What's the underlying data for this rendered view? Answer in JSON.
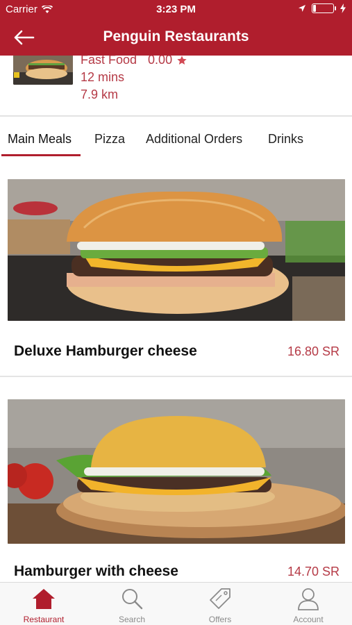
{
  "status_bar": {
    "carrier": "Carrier",
    "time": "3:23 PM"
  },
  "nav": {
    "title": "Penguin Restaurants"
  },
  "restaurant": {
    "category": "Fast Food",
    "rating": "0.00",
    "delivery_time": "12 mins",
    "distance": "7.9 km"
  },
  "tabs": [
    {
      "label": "Main Meals",
      "active": true
    },
    {
      "label": "Pizza"
    },
    {
      "label": "Additional Orders"
    },
    {
      "label": "Drinks"
    }
  ],
  "menu_items": [
    {
      "name": "Deluxe Hamburger cheese",
      "price": "16.80 SR"
    },
    {
      "name": "Hamburger with cheese",
      "price": "14.70 SR"
    }
  ],
  "tabbar": [
    {
      "label": "Restaurant",
      "icon": "home-icon",
      "active": true
    },
    {
      "label": "Search",
      "icon": "search-icon"
    },
    {
      "label": "Offers",
      "icon": "tag-icon"
    },
    {
      "label": "Account",
      "icon": "account-icon"
    }
  ],
  "colors": {
    "brand": "#b01e2d",
    "accent_text": "#b53a46",
    "inactive": "#8a8a8a"
  }
}
